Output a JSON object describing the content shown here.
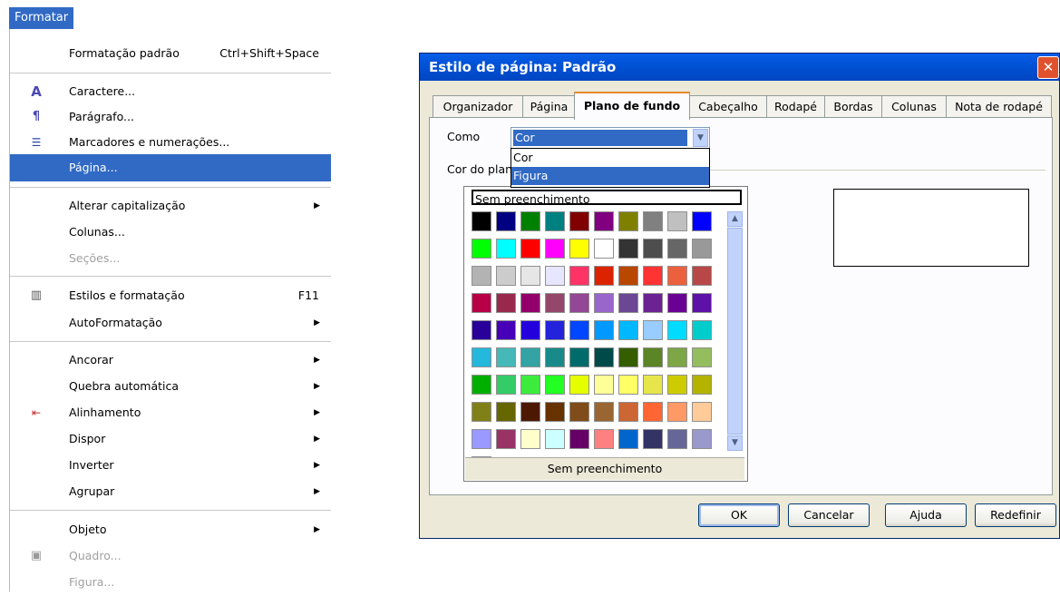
{
  "menubar": {
    "title": "Formatar"
  },
  "menu": {
    "items": [
      {
        "label": "Formatação padrão",
        "shortcut": "Ctrl+Shift+Space",
        "icon": "",
        "submenu": false,
        "disabled": false
      },
      {
        "label": "Caractere...",
        "icon": "character-icon",
        "submenu": false,
        "disabled": false
      },
      {
        "label": "Parágrafo...",
        "icon": "paragraph-icon",
        "submenu": false,
        "disabled": false
      },
      {
        "label": "Marcadores e numerações...",
        "icon": "bullets-icon",
        "submenu": false,
        "disabled": false
      },
      {
        "label": "Página...",
        "icon": "",
        "submenu": false,
        "disabled": false,
        "selected": true
      },
      {
        "label": "Alterar capitalização",
        "submenu": true
      },
      {
        "label": "Colunas..."
      },
      {
        "label": "Seções...",
        "disabled": true
      },
      {
        "label": "Estilos e formatação",
        "shortcut": "F11",
        "icon": "styles-icon"
      },
      {
        "label": "AutoFormatação",
        "submenu": true
      },
      {
        "label": "Ancorar",
        "submenu": true
      },
      {
        "label": "Quebra automática",
        "submenu": true
      },
      {
        "label": "Alinhamento",
        "submenu": true,
        "icon": "align-icon"
      },
      {
        "label": "Dispor",
        "submenu": true
      },
      {
        "label": "Inverter",
        "submenu": true
      },
      {
        "label": "Agrupar",
        "submenu": true
      },
      {
        "label": "Objeto",
        "submenu": true
      },
      {
        "label": "Quadro...",
        "disabled": true,
        "icon": "frame-icon"
      },
      {
        "label": "Figura...",
        "disabled": true
      }
    ]
  },
  "dialog": {
    "title": "Estilo de página: Padrão",
    "close": "✕",
    "tabs": [
      "Organizador",
      "Página",
      "Plano de fundo",
      "Cabeçalho",
      "Rodapé",
      "Bordas",
      "Colunas",
      "Nota de rodapé"
    ],
    "active_tab": "Plano de fundo",
    "como_label": "Como",
    "como_value": "Cor",
    "como_options": [
      "Cor",
      "Figura"
    ],
    "como_highlighted": "Figura",
    "color_section_label": "Cor do plan",
    "picker": {
      "no_fill_top": "Sem preenchimento",
      "no_fill_bottom": "Sem preenchimento",
      "colors": [
        [
          "#000000",
          "#000080",
          "#008000",
          "#008080",
          "#800000",
          "#800080",
          "#808000",
          "#808080",
          "#c0c0c0",
          "#0000ff"
        ],
        [
          "#00ff00",
          "#00ffff",
          "#ff0000",
          "#ff00ff",
          "#ffff00",
          "#ffffff",
          "#333333",
          "#4d4d4d",
          "#666666",
          "#999999"
        ],
        [
          "#b3b3b3",
          "#cccccc",
          "#e6e6e6",
          "#e6e6ff",
          "#ff3366",
          "#dc2300",
          "#b84700",
          "#ff3333",
          "#eb613d",
          "#b84747"
        ],
        [
          "#b80047",
          "#99284d",
          "#94006b",
          "#94476b",
          "#944794",
          "#9966cc",
          "#6b4794",
          "#6b2394",
          "#6b0094",
          "#5e11a6"
        ],
        [
          "#280099",
          "#4700b8",
          "#2300dc",
          "#2323dc",
          "#0047ff",
          "#0099ff",
          "#00b8ff",
          "#99ccff",
          "#00dcff",
          "#00cccc"
        ],
        [
          "#23b8dc",
          "#47b8b8",
          "#33a3a3",
          "#198a8a",
          "#006b6b",
          "#004a4a",
          "#355e00",
          "#5c8526",
          "#7da647",
          "#94bd5e"
        ],
        [
          "#00ae00",
          "#33cc66",
          "#3deb3d",
          "#23ff23",
          "#e6ff00",
          "#ffff99",
          "#ffff66",
          "#e6e64c",
          "#cccc00",
          "#b3b300"
        ],
        [
          "#808019",
          "#666600",
          "#4c1900",
          "#663300",
          "#804c19",
          "#996633",
          "#cc6633",
          "#ff6633",
          "#ff9966",
          "#ffcc99"
        ],
        [
          "#9999ff",
          "#993366",
          "#ffffcc",
          "#ccffff",
          "#660066",
          "#ff8080",
          "#0066cc",
          "#333366",
          "#666699",
          "#9999cc"
        ],
        [
          "#ccccff"
        ]
      ]
    },
    "buttons": {
      "ok": "OK",
      "cancel": "Cancelar",
      "help": "Ajuda",
      "reset": "Redefinir"
    }
  }
}
